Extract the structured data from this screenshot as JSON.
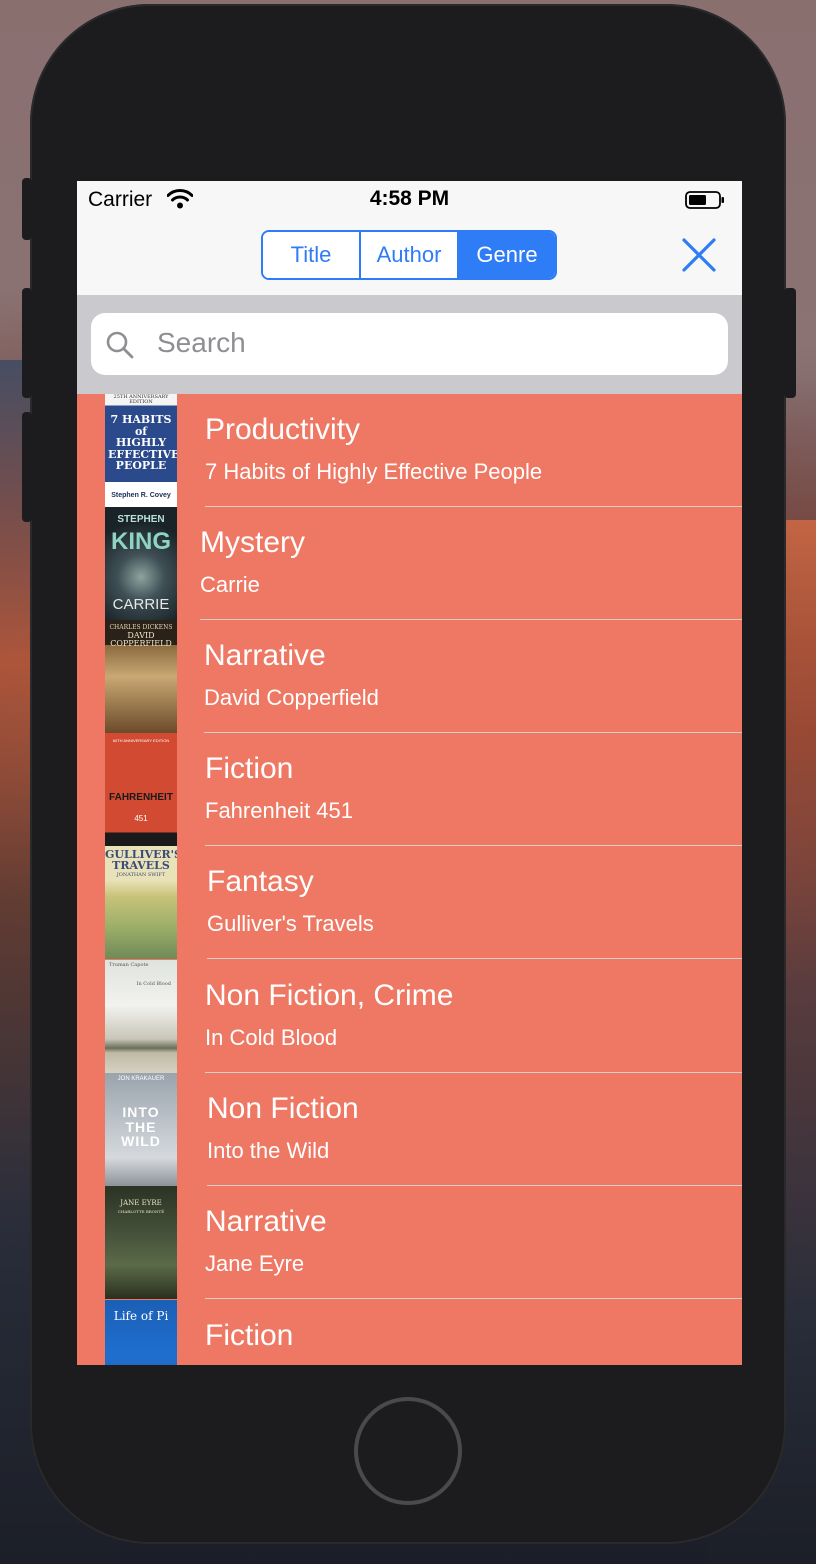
{
  "status_bar": {
    "carrier": "Carrier",
    "time": "4:58 PM"
  },
  "segmented_control": {
    "options": [
      "Title",
      "Author",
      "Genre"
    ],
    "selected": "Genre"
  },
  "search": {
    "placeholder": "Search"
  },
  "books": [
    {
      "genre": "Productivity",
      "title": "7 Habits of Highly Effective People",
      "cover": {
        "top": "25TH ANNIVERSARY EDITION",
        "main": "7 HABITS of HIGHLY EFFECTIVE PEOPLE",
        "bottom": "Stephen R. Covey"
      }
    },
    {
      "genre": "Mystery",
      "title": "Carrie",
      "cover": {
        "top": "STEPHEN",
        "main": "KING",
        "bottom": "CARRIE"
      }
    },
    {
      "genre": "Narrative",
      "title": "David Copperfield",
      "cover": {
        "top": "CHARLES DICKENS",
        "main": "DAVID COPPERFIELD",
        "bottom": ""
      }
    },
    {
      "genre": "Fiction",
      "title": "Fahrenheit 451",
      "cover": {
        "top": "60TH ANNIVERSARY EDITION",
        "main": "FAHRENHEIT",
        "bottom": "451"
      }
    },
    {
      "genre": "Fantasy",
      "title": "Gulliver's Travels",
      "cover": {
        "top": "GULLIVER'S",
        "main": "TRAVELS",
        "bottom": "JONATHAN SWIFT"
      }
    },
    {
      "genre": "Non Fiction, Crime",
      "title": "In Cold Blood",
      "cover": {
        "top": "Truman Capote",
        "main": "In Cold Blood",
        "bottom": ""
      }
    },
    {
      "genre": "Non Fiction",
      "title": "Into the Wild",
      "cover": {
        "top": "JON KRAKAUER",
        "main": "INTO THE WILD",
        "bottom": ""
      }
    },
    {
      "genre": "Narrative",
      "title": "Jane Eyre",
      "cover": {
        "top": "JANE EYRE",
        "main": "",
        "bottom": "CHARLOTTE BRONTË"
      }
    },
    {
      "genre": "Fiction",
      "title": "Life of Pi",
      "cover": {
        "top": "",
        "main": "Life of Pi",
        "bottom": ""
      }
    }
  ],
  "colors": {
    "accent": "#2e7cf6",
    "list_background": "#ee7863",
    "nav_background": "#f7f7f7",
    "search_background": "#c9c9ce"
  }
}
